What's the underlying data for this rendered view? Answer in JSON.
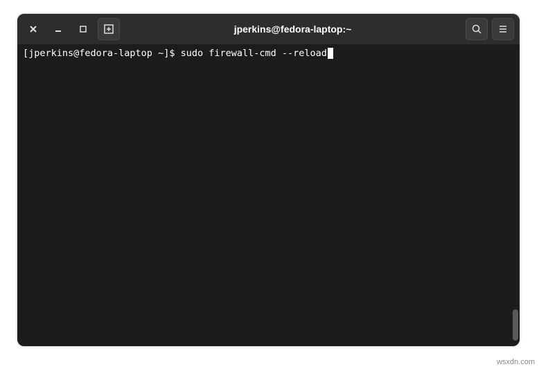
{
  "window": {
    "title": "jperkins@fedora-laptop:~"
  },
  "terminal": {
    "prompt": "[jperkins@fedora-laptop ~]$ ",
    "command": "sudo firewall-cmd --reload"
  },
  "watermark": "wsxdn.com"
}
